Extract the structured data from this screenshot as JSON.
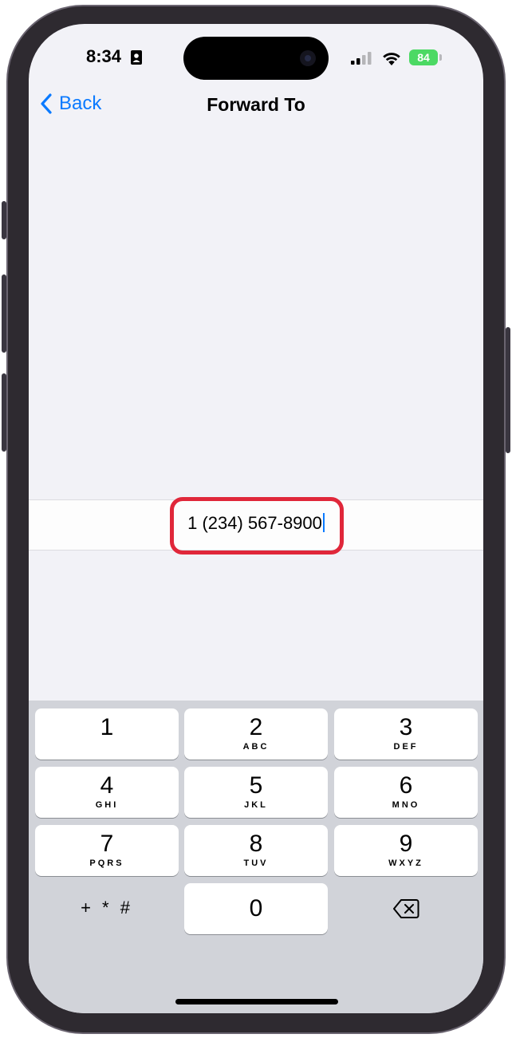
{
  "status_bar": {
    "time": "8:34",
    "battery_percent": "84",
    "icons": [
      "contact-card-icon",
      "signal-icon",
      "wifi-icon",
      "battery-charging-icon"
    ]
  },
  "nav": {
    "back_label": "Back",
    "title": "Forward To"
  },
  "field": {
    "value": "1 (234) 567-8900"
  },
  "keypad": {
    "keys": [
      {
        "num": "1",
        "letters": ""
      },
      {
        "num": "2",
        "letters": "ABC"
      },
      {
        "num": "3",
        "letters": "DEF"
      },
      {
        "num": "4",
        "letters": "GHI"
      },
      {
        "num": "5",
        "letters": "JKL"
      },
      {
        "num": "6",
        "letters": "MNO"
      },
      {
        "num": "7",
        "letters": "PQRS"
      },
      {
        "num": "8",
        "letters": "TUV"
      },
      {
        "num": "9",
        "letters": "WXYZ"
      },
      {
        "num": "0",
        "letters": ""
      }
    ],
    "symbols_label": "+ * #"
  },
  "colors": {
    "accent": "#0a7aff",
    "highlight": "#e0273a",
    "battery": "#4cd964"
  }
}
